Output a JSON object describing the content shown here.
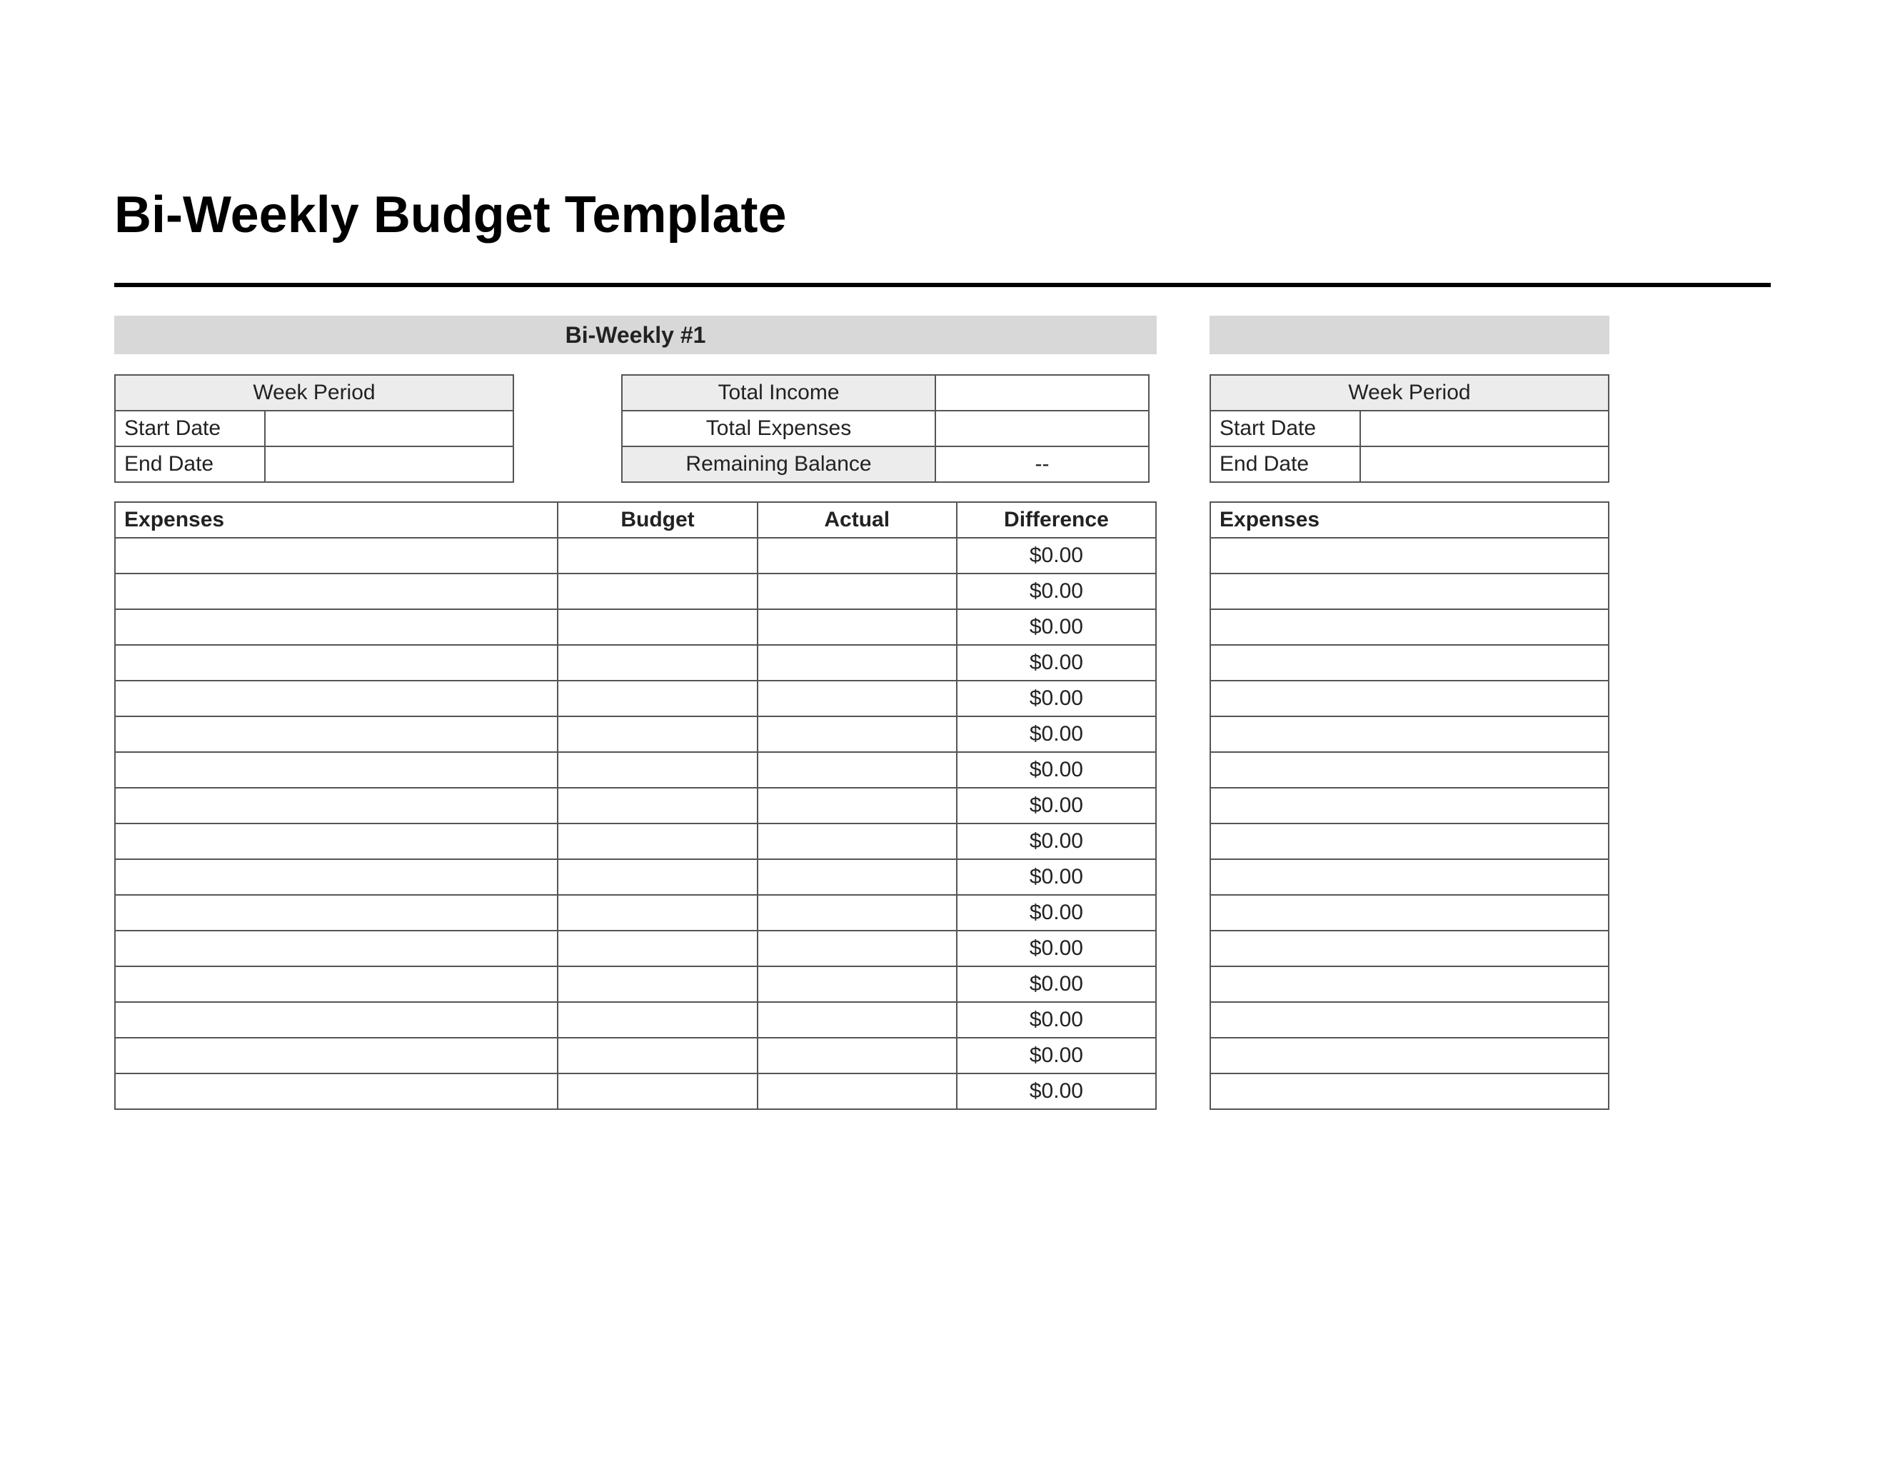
{
  "title": "Bi-Weekly Budget Template",
  "left": {
    "section_header": "Bi-Weekly #1",
    "period": {
      "header": "Week Period",
      "start_label": "Start Date",
      "start_value": "",
      "end_label": "End Date",
      "end_value": ""
    },
    "totals": {
      "income_label": "Total Income",
      "income_value": "",
      "expenses_label": "Total Expenses",
      "expenses_value": "",
      "balance_label": "Remaining Balance",
      "balance_value": "--"
    },
    "expenses": {
      "headers": {
        "expenses": "Expenses",
        "budget": "Budget",
        "actual": "Actual",
        "difference": "Difference"
      },
      "rows": [
        {
          "exp": "",
          "bud": "",
          "act": "",
          "dif": "$0.00"
        },
        {
          "exp": "",
          "bud": "",
          "act": "",
          "dif": "$0.00"
        },
        {
          "exp": "",
          "bud": "",
          "act": "",
          "dif": "$0.00"
        },
        {
          "exp": "",
          "bud": "",
          "act": "",
          "dif": "$0.00"
        },
        {
          "exp": "",
          "bud": "",
          "act": "",
          "dif": "$0.00"
        },
        {
          "exp": "",
          "bud": "",
          "act": "",
          "dif": "$0.00"
        },
        {
          "exp": "",
          "bud": "",
          "act": "",
          "dif": "$0.00"
        },
        {
          "exp": "",
          "bud": "",
          "act": "",
          "dif": "$0.00"
        },
        {
          "exp": "",
          "bud": "",
          "act": "",
          "dif": "$0.00"
        },
        {
          "exp": "",
          "bud": "",
          "act": "",
          "dif": "$0.00"
        },
        {
          "exp": "",
          "bud": "",
          "act": "",
          "dif": "$0.00"
        },
        {
          "exp": "",
          "bud": "",
          "act": "",
          "dif": "$0.00"
        },
        {
          "exp": "",
          "bud": "",
          "act": "",
          "dif": "$0.00"
        },
        {
          "exp": "",
          "bud": "",
          "act": "",
          "dif": "$0.00"
        },
        {
          "exp": "",
          "bud": "",
          "act": "",
          "dif": "$0.00"
        },
        {
          "exp": "",
          "bud": "",
          "act": "",
          "dif": "$0.00"
        }
      ]
    }
  },
  "right": {
    "period": {
      "header": "Week Period",
      "start_label": "Start Date",
      "start_value": "",
      "end_label": "End Date",
      "end_value": ""
    },
    "expenses": {
      "header": "Expenses",
      "rows": [
        "",
        "",
        "",
        "",
        "",
        "",
        "",
        "",
        "",
        "",
        "",
        "",
        "",
        "",
        "",
        ""
      ]
    }
  }
}
